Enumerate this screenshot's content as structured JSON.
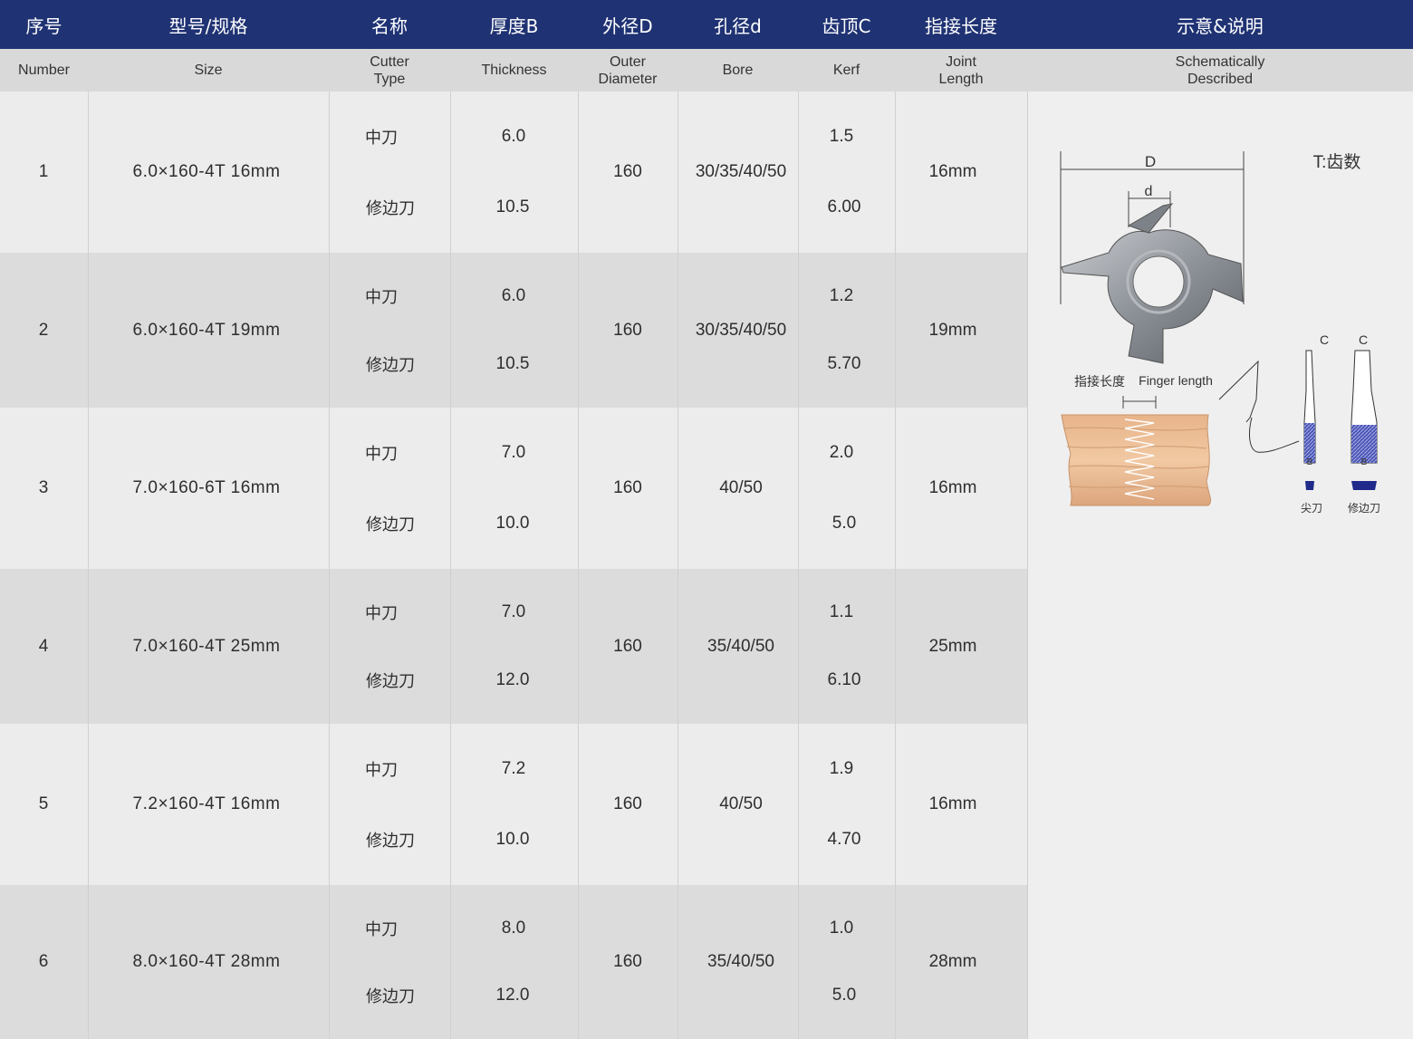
{
  "header": {
    "zh": [
      "序号",
      "型号/规格",
      "名称",
      "厚度B",
      "外径D",
      "孔径d",
      "齿顶C",
      "指接长度",
      "示意&说明"
    ],
    "en": [
      "Number",
      "Size",
      "Cutter\nType",
      "Thickness",
      "Outer\nDiameter",
      "Bore",
      "Kerf",
      "Joint\nLength",
      "Schematically\nDescribed"
    ]
  },
  "rows": [
    {
      "number": "1",
      "size": "6.0×160-4T 16mm",
      "type_a": "中刀",
      "type_b": "修边刀",
      "thick_a": "6.0",
      "thick_b": "10.5",
      "outer": "160",
      "bore": "30/35/40/50",
      "kerf_a": "1.5",
      "kerf_b": "6.00",
      "joint": "16mm"
    },
    {
      "number": "2",
      "size": "6.0×160-4T 19mm",
      "type_a": "中刀",
      "type_b": "修边刀",
      "thick_a": "6.0",
      "thick_b": "10.5",
      "outer": "160",
      "bore": "30/35/40/50",
      "kerf_a": "1.2",
      "kerf_b": "5.70",
      "joint": "19mm"
    },
    {
      "number": "3",
      "size": "7.0×160-6T 16mm",
      "type_a": "中刀",
      "type_b": "修边刀",
      "thick_a": "7.0",
      "thick_b": "10.0",
      "outer": "160",
      "bore": "40/50",
      "kerf_a": "2.0",
      "kerf_b": "5.0",
      "joint": "16mm"
    },
    {
      "number": "4",
      "size": "7.0×160-4T 25mm",
      "type_a": "中刀",
      "type_b": "修边刀",
      "thick_a": "7.0",
      "thick_b": "12.0",
      "outer": "160",
      "bore": "35/40/50",
      "kerf_a": "1.1",
      "kerf_b": "6.10",
      "joint": "25mm"
    },
    {
      "number": "5",
      "size": "7.2×160-4T 16mm",
      "type_a": "中刀",
      "type_b": "修边刀",
      "thick_a": "7.2",
      "thick_b": "10.0",
      "outer": "160",
      "bore": "40/50",
      "kerf_a": "1.9",
      "kerf_b": "4.70",
      "joint": "16mm"
    },
    {
      "number": "6",
      "size": "8.0×160-4T 28mm",
      "type_a": "中刀",
      "type_b": "修边刀",
      "thick_a": "8.0",
      "thick_b": "12.0",
      "outer": "160",
      "bore": "35/40/50",
      "kerf_a": "1.0",
      "kerf_b": "5.0",
      "joint": "28mm"
    }
  ],
  "diagram": {
    "label_D": "D",
    "label_d": "d",
    "teeth_note": "T:齿数",
    "finger_zh": "指接长度",
    "finger_en": "Finger  length",
    "label_C1": "C",
    "label_C2": "C",
    "label_B1": "B",
    "label_B2": "B",
    "cutter_a": "尖刀",
    "cutter_b": "修边刀"
  },
  "colors": {
    "header_bg": "#1f3273",
    "subheader_bg": "#d9d9d9",
    "row_light": "#ececec",
    "row_dark": "#dcdcdc",
    "accent_blue": "#1f2a8a"
  }
}
